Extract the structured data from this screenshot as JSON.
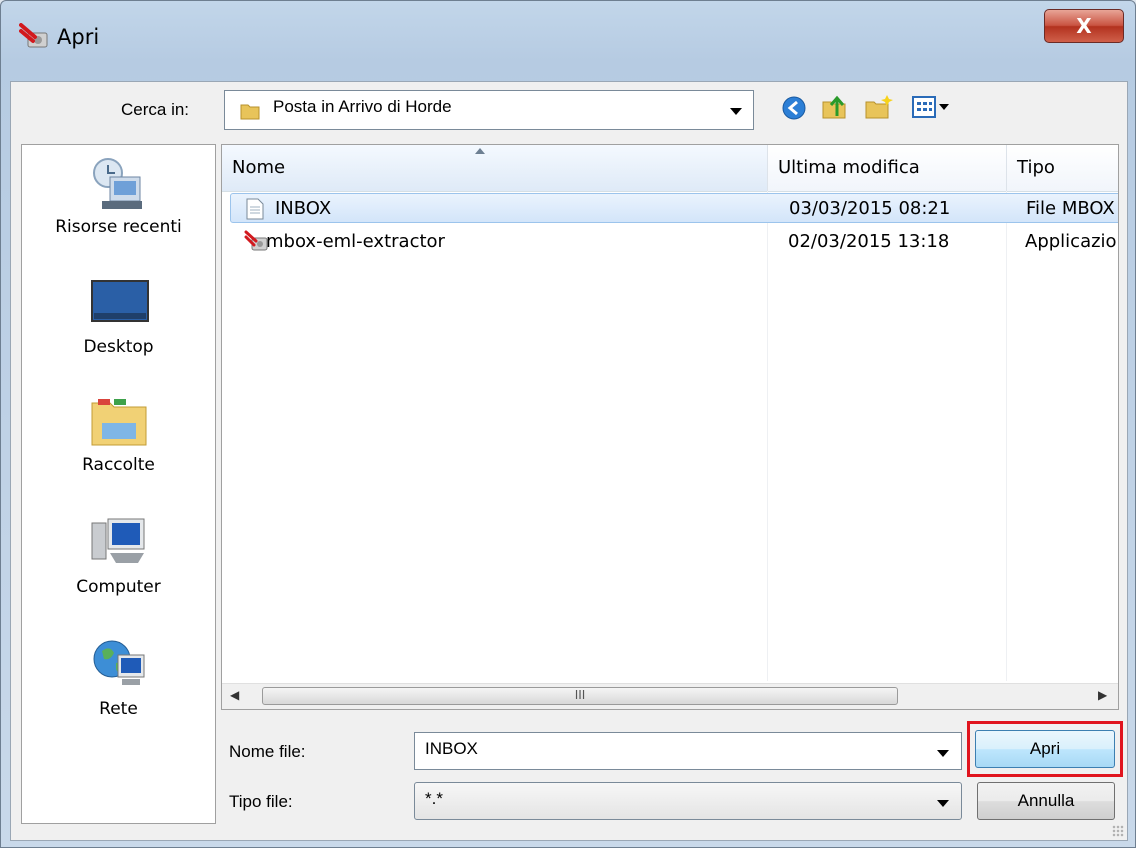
{
  "window": {
    "title": "Apri",
    "close_glyph": "X"
  },
  "lookin": {
    "label": "Cerca in:",
    "value": "Posta in Arrivo di Horde"
  },
  "toolbar": {
    "back": "back-icon",
    "up": "up-folder-icon",
    "newfolder": "new-folder-icon",
    "views": "view-menu-icon"
  },
  "places": [
    {
      "label": "Risorse recenti",
      "icon": "recent-places-icon"
    },
    {
      "label": "Desktop",
      "icon": "desktop-icon"
    },
    {
      "label": "Raccolte",
      "icon": "libraries-icon"
    },
    {
      "label": "Computer",
      "icon": "computer-icon"
    },
    {
      "label": "Rete",
      "icon": "network-icon"
    }
  ],
  "columns": {
    "name": "Nome",
    "modified": "Ultima modifica",
    "type": "Tipo",
    "sort_glyph": "^"
  },
  "files": [
    {
      "name": "INBOX",
      "modified": "03/03/2015 08:21",
      "type": "File MBOX",
      "selected": true
    },
    {
      "name": "mbox-eml-extractor",
      "modified": "02/03/2015 13:18",
      "type": "Applicazione",
      "selected": false
    }
  ],
  "scrollbar": {
    "left_glyph": "◀",
    "right_glyph": "▶",
    "grip": "III"
  },
  "filename": {
    "label": "Nome file:",
    "value": "INBOX"
  },
  "filetype": {
    "label": "Tipo file:",
    "value": "*.*"
  },
  "buttons": {
    "open": "Apri",
    "cancel": "Annulla"
  },
  "colors": {
    "highlight": "#e0141e",
    "selection": "#d3e5fa"
  }
}
